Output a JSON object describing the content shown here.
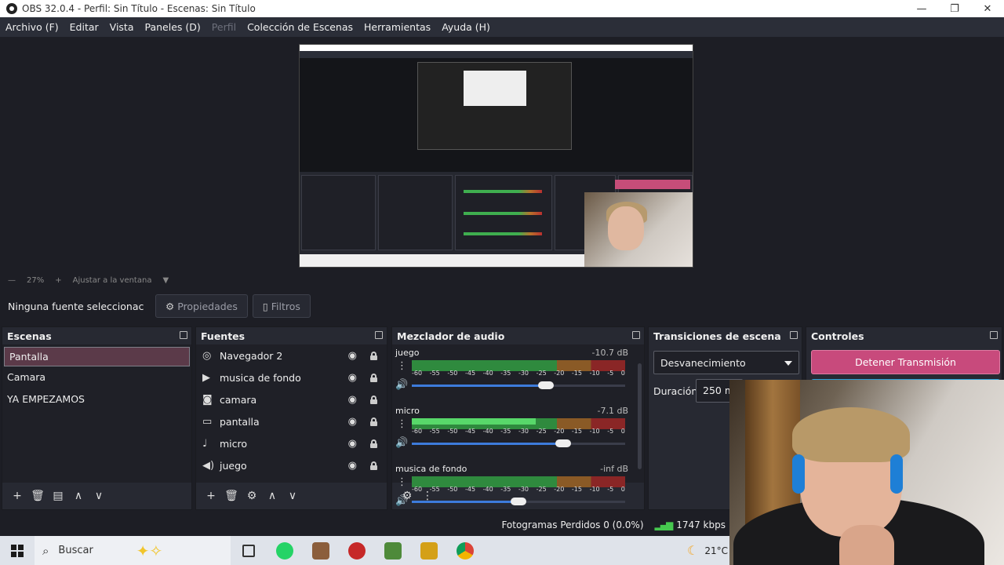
{
  "window": {
    "title": "OBS 32.0.4 - Perfil: Sin Título - Escenas: Sin Título",
    "controls": [
      "—",
      "❐",
      "✕"
    ]
  },
  "menu": {
    "items": [
      {
        "label": "Archivo (F)",
        "enabled": true
      },
      {
        "label": "Editar",
        "enabled": true
      },
      {
        "label": "Vista",
        "enabled": true
      },
      {
        "label": "Paneles (D)",
        "enabled": true
      },
      {
        "label": "Perfil",
        "enabled": false
      },
      {
        "label": "Colección de Escenas",
        "enabled": true
      },
      {
        "label": "Herramientas",
        "enabled": true
      },
      {
        "label": "Ayuda (H)",
        "enabled": true
      }
    ]
  },
  "zoom": {
    "minus": "—",
    "value": "27%",
    "plus": "+",
    "fit_label": "Ajustar a la ventana"
  },
  "source_toolbar": {
    "no_source": "Ninguna fuente seleccionac",
    "properties": "Propiedades",
    "filters": "Filtros"
  },
  "scenes": {
    "title": "Escenas",
    "items": [
      "Pantalla",
      "Camara",
      "YA EMPEZAMOS"
    ],
    "selected": "Pantalla"
  },
  "sources": {
    "title": "Fuentes",
    "items": [
      {
        "name": "Navegador 2",
        "icon": "globe-icon"
      },
      {
        "name": "musica de fondo",
        "icon": "play-icon"
      },
      {
        "name": "camara",
        "icon": "camera-icon"
      },
      {
        "name": "pantalla",
        "icon": "monitor-icon"
      },
      {
        "name": "micro",
        "icon": "microphone-icon"
      },
      {
        "name": "juego",
        "icon": "speaker-icon"
      }
    ]
  },
  "mixer": {
    "title": "Mezclador de audio",
    "ticks": [
      "-60",
      "-55",
      "-50",
      "-45",
      "-40",
      "-35",
      "-30",
      "-25",
      "-20",
      "-15",
      "-10",
      "-5",
      "0"
    ],
    "channels": [
      {
        "name": "juego",
        "db": "-10.7 dB",
        "level": 0,
        "volume": 0.63
      },
      {
        "name": "micro",
        "db": "-7.1 dB",
        "level": 0.58,
        "volume": 0.71
      },
      {
        "name": "musica de fondo",
        "db": "-inf dB",
        "level": 0,
        "volume": 0.5
      }
    ]
  },
  "transitions": {
    "title": "Transiciones de escena",
    "selected": "Desvanecimiento",
    "duration_label": "Duración",
    "duration_value": "250 m"
  },
  "controls": {
    "title": "Controles",
    "stop_stream": "Detener Transmisión"
  },
  "status": {
    "frames_dropped": "Fotogramas Perdidos 0 (0.0%)",
    "bitrate": "1747 kbps"
  },
  "taskbar": {
    "search": "Buscar",
    "weather": "21°C"
  },
  "colors": {
    "accent": "#c84a7c",
    "selected_scene": "#5b3a49",
    "meter_green": "#2f8a3e",
    "slider_blue": "#3d7bdb"
  }
}
